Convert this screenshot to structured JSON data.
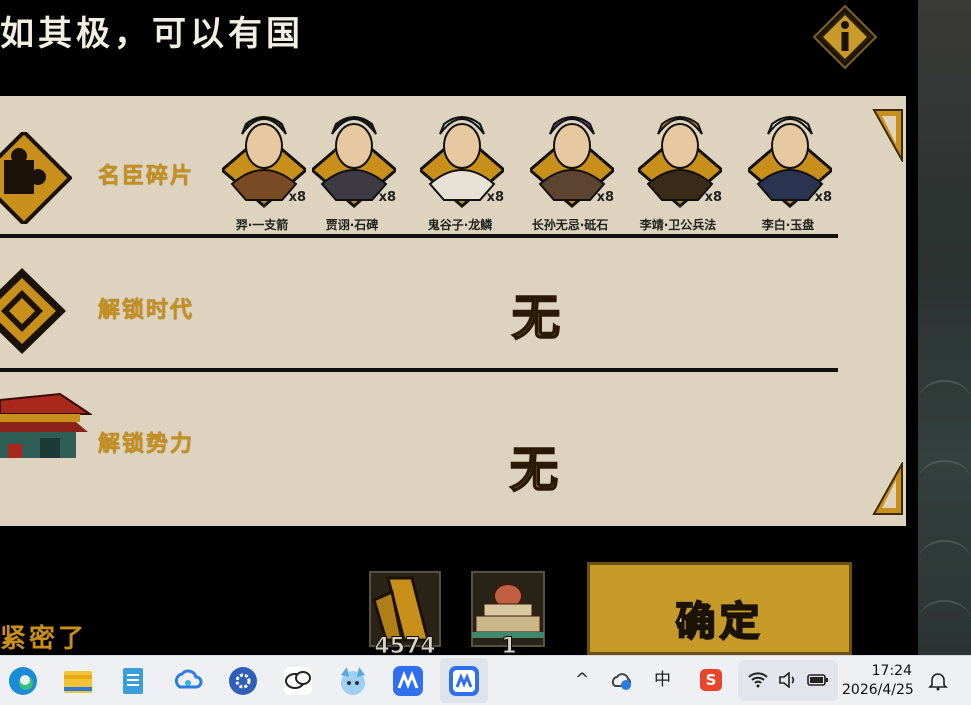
{
  "game": {
    "title": "如其极，可以有国",
    "info_icon": "info-icon",
    "rows": [
      {
        "key": "fragments",
        "label": "名臣碎片",
        "icon": "puzzle-icon"
      },
      {
        "key": "era",
        "label": "解锁时代",
        "icon": "diamond-emblem-icon",
        "value": "无"
      },
      {
        "key": "faction",
        "label": "解锁势力",
        "icon": "palace-icon",
        "value": "无"
      }
    ],
    "heroes": [
      {
        "name": "羿·一支箭",
        "count": "x8"
      },
      {
        "name": "贾诩·石碑",
        "count": "x8"
      },
      {
        "name": "鬼谷子·龙鳞",
        "count": "x8"
      },
      {
        "name": "长孙无忌·砥石",
        "count": "x8"
      },
      {
        "name": "李靖·卫公兵法",
        "count": "x8"
      },
      {
        "name": "李白·玉盘",
        "count": "x8"
      }
    ],
    "resources": [
      {
        "icon": "arrow-token-icon",
        "value": "4574"
      },
      {
        "icon": "palace-token-icon",
        "value": "1"
      }
    ],
    "confirm_label": "确定",
    "bottom_text": "紧密了"
  },
  "taskbar": {
    "apps": [
      "edge-icon",
      "file-explorer-icon",
      "notepad-icon",
      "cloud-drive-icon",
      "settings-gear-icon",
      "chat-app-icon",
      "anime-avatar-app-icon",
      "meitu-app-icon",
      "meitu-active-app-icon"
    ],
    "tray": {
      "chevron": "^",
      "ime": "中",
      "sogou": "S"
    },
    "time": "17:24",
    "date": "2026/4/25"
  },
  "colors": {
    "accent_gold": "#c8901a",
    "panel": "#ddd3be",
    "confirm": "#c59a28"
  }
}
